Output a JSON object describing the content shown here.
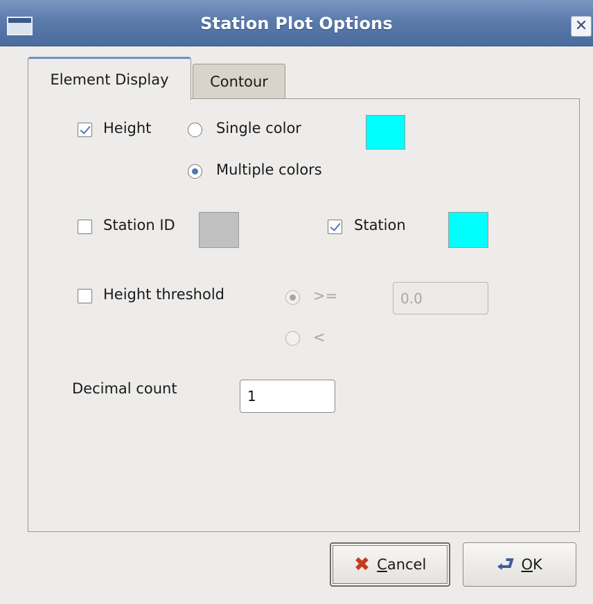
{
  "window": {
    "title": "Station Plot Options",
    "close_glyph": "✕"
  },
  "tabs": [
    {
      "label": "Element Display",
      "active": true
    },
    {
      "label": "Contour",
      "active": false
    }
  ],
  "height_row": {
    "checkbox_label": "Height",
    "checked": true,
    "single_color_label": "Single color",
    "multiple_colors_label": "Multiple colors",
    "selected": "multiple",
    "swatch_color": "#00ffff"
  },
  "station_row": {
    "station_id_label": "Station ID",
    "station_id_checked": false,
    "station_id_swatch_color": "#c0c0c0",
    "station_label": "Station",
    "station_checked": true,
    "station_swatch_color": "#00ffff"
  },
  "threshold_row": {
    "label": "Height threshold",
    "checked": false,
    "gte_label": ">=",
    "lt_label": "<",
    "selected": "gte",
    "value": "0.0"
  },
  "decimal_row": {
    "label": "Decimal count",
    "value": "1"
  },
  "buttons": {
    "cancel_mnemonic": "C",
    "cancel_rest": "ancel",
    "ok_mnemonic": "O",
    "ok_rest": "K"
  },
  "icons": {
    "cancel": "cancel-x-icon",
    "ok": "ok-return-icon"
  }
}
